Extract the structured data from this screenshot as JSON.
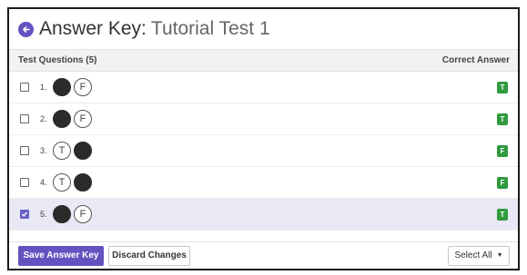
{
  "header": {
    "title_key": "Answer Key:",
    "title_name": "Tutorial Test 1",
    "back_icon": "circle-arrow-left-icon"
  },
  "table": {
    "col_questions": "Test Questions (5)",
    "col_answer": "Correct Answer"
  },
  "questions": [
    {
      "num": "1.",
      "first": "",
      "second": "F",
      "filled": "first",
      "answer": "T",
      "checked": false
    },
    {
      "num": "2.",
      "first": "",
      "second": "F",
      "filled": "first",
      "answer": "T",
      "checked": false
    },
    {
      "num": "3.",
      "first": "T",
      "second": "",
      "filled": "second",
      "answer": "F",
      "checked": false
    },
    {
      "num": "4.",
      "first": "T",
      "second": "",
      "filled": "second",
      "answer": "F",
      "checked": false
    },
    {
      "num": "5.",
      "first": "",
      "second": "F",
      "filled": "first",
      "answer": "T",
      "checked": true
    }
  ],
  "footer": {
    "save_label": "Save Answer Key",
    "discard_label": "Discard Changes",
    "select_all_label": "Select All"
  },
  "colors": {
    "accent": "#6353c0",
    "answer_badge": "#2f9a3e",
    "selected_row": "#e9e8f5"
  }
}
